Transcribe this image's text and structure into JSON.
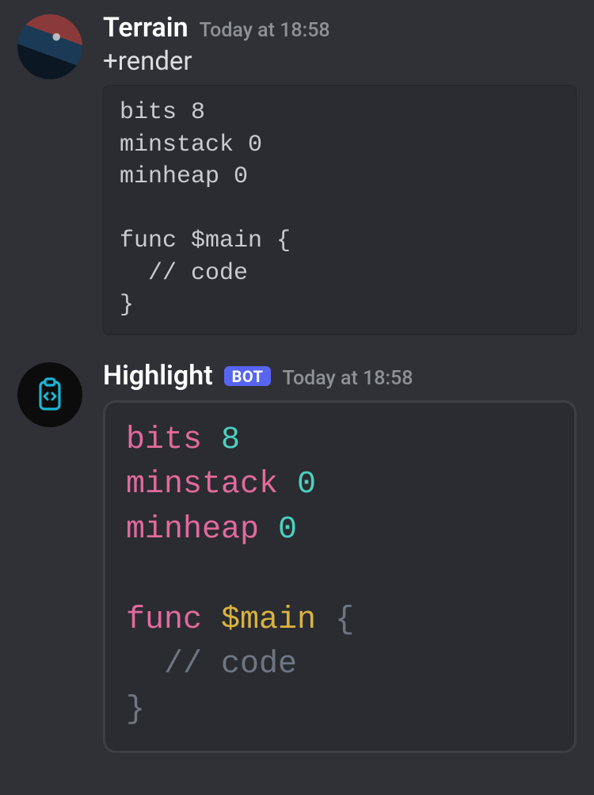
{
  "messages": [
    {
      "author": "Terrain",
      "is_bot": false,
      "timestamp": "Today at 18:58",
      "text": "+render",
      "code_plain": "bits 8\nminstack 0\nminheap 0\n\nfunc $main {\n  // code\n}"
    },
    {
      "author": "Highlight",
      "is_bot": true,
      "bot_tag": "BOT",
      "timestamp": "Today at 18:58",
      "code_tokens": [
        [
          {
            "t": "bits",
            "c": "kw"
          },
          {
            "t": " ",
            "c": ""
          },
          {
            "t": "8",
            "c": "num"
          }
        ],
        [
          {
            "t": "minstack",
            "c": "kw"
          },
          {
            "t": " ",
            "c": ""
          },
          {
            "t": "0",
            "c": "num"
          }
        ],
        [
          {
            "t": "minheap",
            "c": "kw"
          },
          {
            "t": " ",
            "c": ""
          },
          {
            "t": "0",
            "c": "num"
          }
        ],
        [],
        [
          {
            "t": "func",
            "c": "kw"
          },
          {
            "t": " ",
            "c": ""
          },
          {
            "t": "$main",
            "c": "var"
          },
          {
            "t": " ",
            "c": ""
          },
          {
            "t": "{",
            "c": "punc"
          }
        ],
        [
          {
            "t": "  ",
            "c": ""
          },
          {
            "t": "// code",
            "c": "cmnt"
          }
        ],
        [
          {
            "t": "}",
            "c": "punc"
          }
        ]
      ]
    }
  ]
}
